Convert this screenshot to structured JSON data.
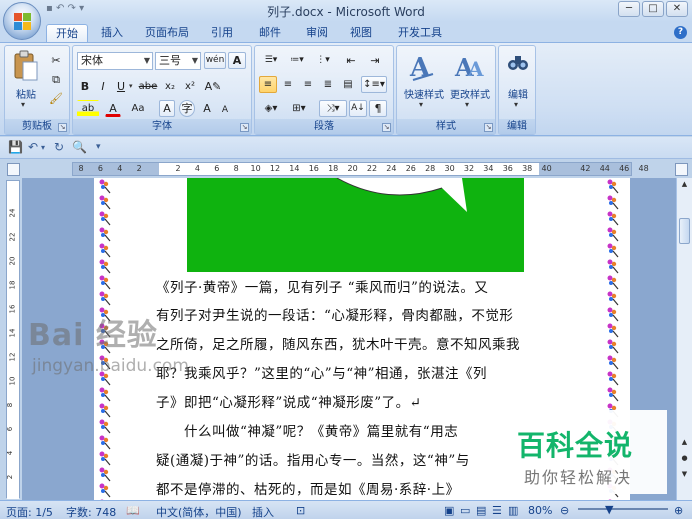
{
  "window": {
    "title": "列子.docx - Microsoft Word",
    "controls": [
      "─",
      "□",
      "✕"
    ]
  },
  "tabs": [
    {
      "label": "开始",
      "active": true
    },
    {
      "label": "插入"
    },
    {
      "label": "页面布局"
    },
    {
      "label": "引用"
    },
    {
      "label": "邮件"
    },
    {
      "label": "审阅"
    },
    {
      "label": "视图"
    },
    {
      "label": "开发工具"
    }
  ],
  "ribbon": {
    "clipboard": {
      "label": "剪贴板",
      "paste_label": "粘贴"
    },
    "font": {
      "label": "字体",
      "font_name": "宋体",
      "font_size": "三号",
      "bold": "B",
      "italic": "I",
      "underline": "U",
      "strike": "abe",
      "subscript": "x₂",
      "superscript": "x²",
      "font_color_letter": "A",
      "grow": "A",
      "shrink": "A",
      "change_case": "Aa",
      "char_shade": "A",
      "wen": "wén"
    },
    "paragraph": {
      "label": "段落"
    },
    "styles": {
      "label": "样式",
      "quick_styles": "快速样式",
      "change_styles": "更改样式"
    },
    "editing": {
      "label": "编辑",
      "edit_label": "编辑"
    }
  },
  "ruler": {
    "horizontal_ticks": [
      "8",
      "6",
      "4",
      "2",
      "",
      "2",
      "4",
      "6",
      "8",
      "10",
      "12",
      "14",
      "16",
      "18",
      "20",
      "22",
      "24",
      "26",
      "28",
      "30",
      "32",
      "34",
      "36",
      "38",
      "40",
      "",
      "42",
      "44",
      "46",
      "48"
    ],
    "vertical_ticks": [
      "24",
      "22",
      "20",
      "18",
      "16",
      "14",
      "12",
      "10",
      "8",
      "6",
      "4",
      "2"
    ]
  },
  "document": {
    "lines": [
      "《列子·黄帝》一篇，见有列子 “乘风而归”的说法。又",
      "有列子对尹生说的一段话：“心凝形释，骨肉都融，不觉形",
      "之所倚，足之所履，随风东西，犹木叶干壳。意不知风乘我",
      "耶？我乘风乎？”这里的“心”与“神”相通，张湛注《列",
      "子》即把“心凝形释”说成“神凝形废”了。↵",
      "　　什么叫做“神凝”呢？《黄帝》篇里就有“用志",
      "疑(通凝)于神”的话。指用心专一。当然，这“神”与",
      "都不是停滞的、枯死的，而是如《周易·系辞·上》"
    ]
  },
  "statusbar": {
    "page": "页面: 1/5",
    "words": "字数: 748",
    "language": "中文(简体，中国)",
    "mode": "插入",
    "zoom": "80%"
  },
  "watermarks": {
    "baidu": "Bai 经验",
    "jingyan": "jingyan.baidu.com",
    "brand": "百科全说",
    "brand_sub": "助你轻松解决"
  }
}
